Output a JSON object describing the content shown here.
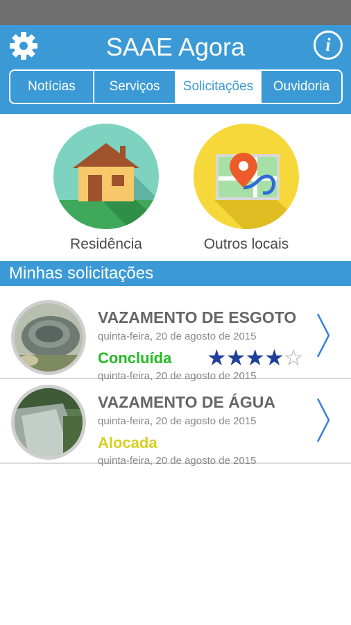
{
  "header": {
    "title": "SAAE Agora",
    "info_label": "i",
    "color": "#3b9ad6"
  },
  "tabs": [
    {
      "label": "Notícias",
      "active": false
    },
    {
      "label": "Serviços",
      "active": false
    },
    {
      "label": "Solicitações",
      "active": true
    },
    {
      "label": "Ouvidoria",
      "active": false
    }
  ],
  "locations": {
    "home_label": "Residência",
    "other_label": "Outros locais",
    "home_icon": "house-icon",
    "other_icon": "map-pin-icon"
  },
  "section": {
    "title": "Minhas solicitações"
  },
  "requests": [
    {
      "title": "VAZAMENTO DE ESGOTO",
      "date_opened": "quinta-feira, 20 de agosto de 2015",
      "status": "Concluída",
      "status_color": "#22bb22",
      "date_updated": "quinta-feira, 20 de agosto de 2015",
      "rating": 4,
      "rating_max": 5
    },
    {
      "title": "VAZAMENTO DE ÁGUA",
      "date_opened": "quinta-feira, 20 de agosto de 2015",
      "status": "Alocada",
      "status_color": "#d8d020",
      "date_updated": "quinta-feira, 20 de agosto de 2015"
    }
  ]
}
